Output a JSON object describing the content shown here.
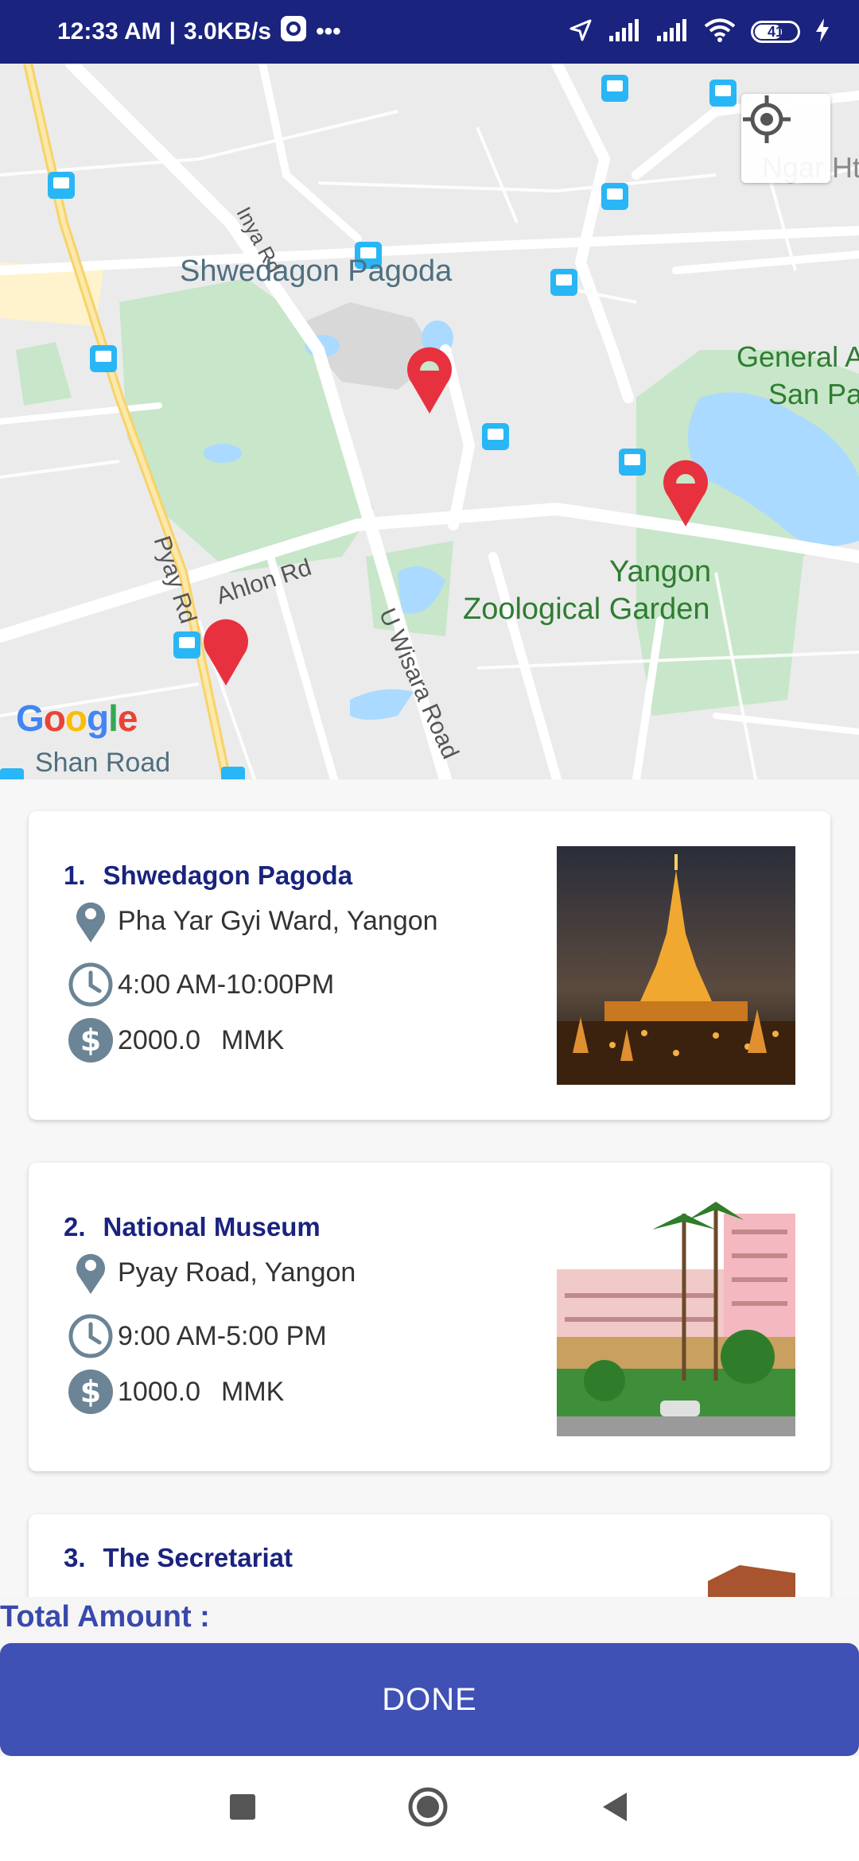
{
  "status_bar": {
    "time": "12:33 AM",
    "network_speed": "3.0KB/s",
    "more": "•••",
    "battery": "41"
  },
  "map": {
    "labels": {
      "inya_rd": "Inya Rd",
      "shwedagon": "Shwedagon Pagoda",
      "general": "General A",
      "san_pa": "San Pa",
      "yangon": "Yangon",
      "zoo": "Zoological Garden",
      "ahlon": "Ahlon Rd",
      "pyay": "Pyay Rd",
      "u_wisara": "U Wisara Road",
      "shan": "Shan Road",
      "ngar": "Ngar Ht"
    },
    "google": "Google",
    "pin_color": "#e8313f"
  },
  "places": [
    {
      "index": "1.",
      "name": "Shwedagon Pagoda",
      "address": "Pha Yar Gyi Ward, Yangon",
      "hours": "4:00 AM-10:00PM",
      "price": "2000.0",
      "currency": "MMK"
    },
    {
      "index": "2.",
      "name": "National Museum",
      "address": "Pyay Road, Yangon",
      "hours": "9:00 AM-5:00 PM",
      "price": "1000.0",
      "currency": "MMK"
    },
    {
      "index": "3.",
      "name": "The Secretariat"
    }
  ],
  "footer": {
    "total_label": "Total Amount :",
    "done_label": "DONE"
  },
  "colors": {
    "accent": "#3f51b5",
    "title": "#1a237e",
    "status_bar": "#1a237e",
    "icon": "#6b8496"
  }
}
